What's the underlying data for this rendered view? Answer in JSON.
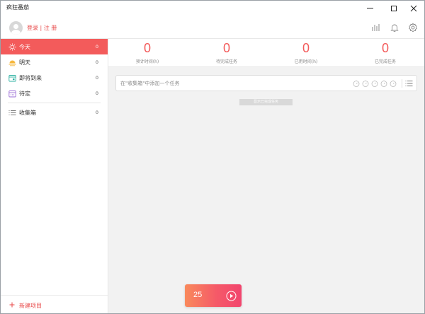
{
  "window": {
    "title": "疯狂番茄"
  },
  "header": {
    "login_text": "登录 | 注 册"
  },
  "sidebar": {
    "items": [
      {
        "label": "今天",
        "count": "0"
      },
      {
        "label": "明天",
        "count": "0"
      },
      {
        "label": "即将到来",
        "count": "0"
      },
      {
        "label": "待定",
        "count": "0"
      },
      {
        "label": "收集箱",
        "count": "0"
      }
    ],
    "new_project": "新建项目"
  },
  "stats": [
    {
      "value": "0",
      "caption": "预计时间(h)"
    },
    {
      "value": "0",
      "caption": "待完成任务"
    },
    {
      "value": "0",
      "caption": "已用时间(h)"
    },
    {
      "value": "0",
      "caption": "已完成任务"
    }
  ],
  "task_input": {
    "placeholder": "在\"收集箱\"中添加一个任务"
  },
  "show_completed": "显示已完成任务",
  "timer": {
    "minutes": "25"
  },
  "colors": {
    "accent": "#f35b5b",
    "link": "#e84a4a",
    "timer_start": "#f98a5c",
    "timer_end": "#f2456e"
  }
}
